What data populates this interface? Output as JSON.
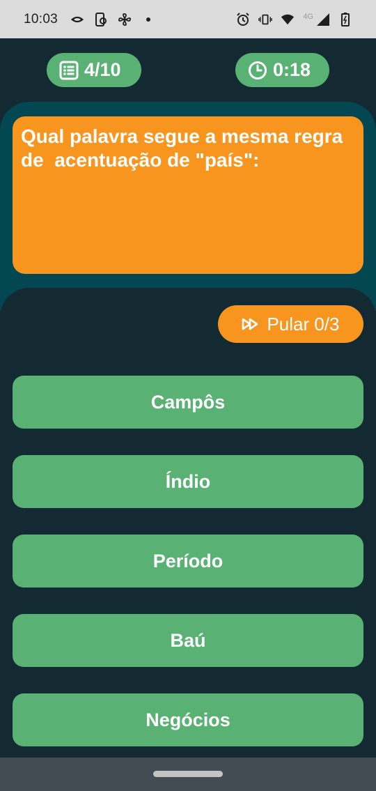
{
  "status_bar": {
    "time": "10:03",
    "network_label": "4G",
    "left_icons": [
      "eye-icon",
      "phone-sync-icon",
      "fan-icon",
      "dot-icon"
    ],
    "right_icons": [
      "alarm-icon",
      "vibrate-icon",
      "wifi-icon",
      "signal-icon",
      "battery-icon"
    ]
  },
  "header": {
    "progress": "4/10",
    "timer": "0:18",
    "progress_icon": "list-icon",
    "timer_icon": "clock-icon"
  },
  "question": {
    "text": "Qual palavra segue a mesma regra\nde  acentuação de \"país\":"
  },
  "skip": {
    "label": "Pular 0/3",
    "icon": "skip-icon"
  },
  "answers": [
    "Campôs",
    "Índio",
    "Período",
    "Baú",
    "Negócios"
  ],
  "colors": {
    "background": "#132a33",
    "question_panel": "#034752",
    "accent_orange": "#f7951f",
    "accent_green": "#59b274",
    "status_bar": "#dcdcdc",
    "nav_bar": "#434c53"
  }
}
